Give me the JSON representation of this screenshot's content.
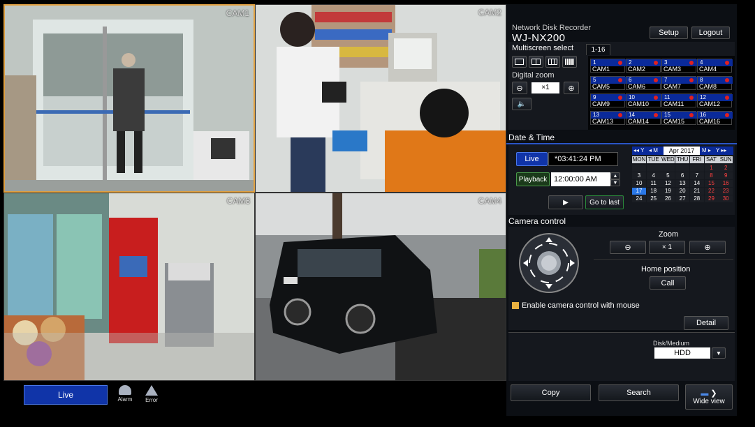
{
  "cameras": [
    {
      "label": "CAM1",
      "selected": true
    },
    {
      "label": "CAM2",
      "selected": false
    },
    {
      "label": "CAM3",
      "selected": false
    },
    {
      "label": "CAM4",
      "selected": false
    }
  ],
  "bottom_bar": {
    "live_label": "Live",
    "alarm_label": "Alarm",
    "error_label": "Error"
  },
  "header": {
    "product": "Network Disk Recorder",
    "model": "WJ-NX200",
    "setup_label": "Setup",
    "logout_label": "Logout"
  },
  "multiscreen": {
    "title": "Multiscreen select",
    "page_tab": "1-16",
    "digital_zoom_label": "Digital zoom",
    "zoom_value": "×1",
    "tiles": [
      {
        "num": "1",
        "cam": "CAM1"
      },
      {
        "num": "2",
        "cam": "CAM2"
      },
      {
        "num": "3",
        "cam": "CAM3"
      },
      {
        "num": "4",
        "cam": "CAM4"
      },
      {
        "num": "5",
        "cam": "CAM5"
      },
      {
        "num": "6",
        "cam": "CAM6"
      },
      {
        "num": "7",
        "cam": "CAM7"
      },
      {
        "num": "8",
        "cam": "CAM8"
      },
      {
        "num": "9",
        "cam": "CAM9"
      },
      {
        "num": "10",
        "cam": "CAM10"
      },
      {
        "num": "11",
        "cam": "CAM11"
      },
      {
        "num": "12",
        "cam": "CAM12"
      },
      {
        "num": "13",
        "cam": "CAM13"
      },
      {
        "num": "14",
        "cam": "CAM14"
      },
      {
        "num": "15",
        "cam": "CAM15"
      },
      {
        "num": "16",
        "cam": "CAM16"
      }
    ]
  },
  "datetime": {
    "title": "Date & Time",
    "live_label": "Live",
    "live_time": "*03:41:24 PM",
    "playback_label": "Playback",
    "playback_time": "12:00:00 AM",
    "go_to_last_label": "Go to last",
    "calendar": {
      "nav_prev_year": "◂◂ Y",
      "nav_prev_month": "◂ M",
      "month_year": "Apr 2017",
      "nav_next_month": "M ▸",
      "nav_next_year": "Y ▸▸",
      "weekdays": [
        "MON",
        "TUE",
        "WED",
        "THU",
        "FRI",
        "SAT",
        "SUN"
      ],
      "weeks": [
        [
          "",
          "",
          "",
          "",
          "",
          "1",
          "2"
        ],
        [
          "3",
          "4",
          "5",
          "6",
          "7",
          "8",
          "9"
        ],
        [
          "10",
          "11",
          "12",
          "13",
          "14",
          "15",
          "16"
        ],
        [
          "17",
          "18",
          "19",
          "20",
          "21",
          "22",
          "23"
        ],
        [
          "24",
          "25",
          "26",
          "27",
          "28",
          "29",
          "30"
        ]
      ],
      "today": "17"
    }
  },
  "camera_control": {
    "title": "Camera control",
    "zoom_label": "Zoom",
    "zoom_value": "× 1",
    "home_position_label": "Home position",
    "call_label": "Call",
    "enable_mouse_label": "Enable camera control with mouse",
    "detail_label": "Detail"
  },
  "disk": {
    "label": "Disk/Medium",
    "value": "HDD"
  },
  "footer": {
    "copy_label": "Copy",
    "search_label": "Search",
    "wide_view_label": "Wide view"
  },
  "colors": {
    "accent_blue": "#2b56c8",
    "tile_blue": "#0a2a9a",
    "alarm_red": "#e02020",
    "selected_border": "#e0a040",
    "check": "#e8b040"
  }
}
